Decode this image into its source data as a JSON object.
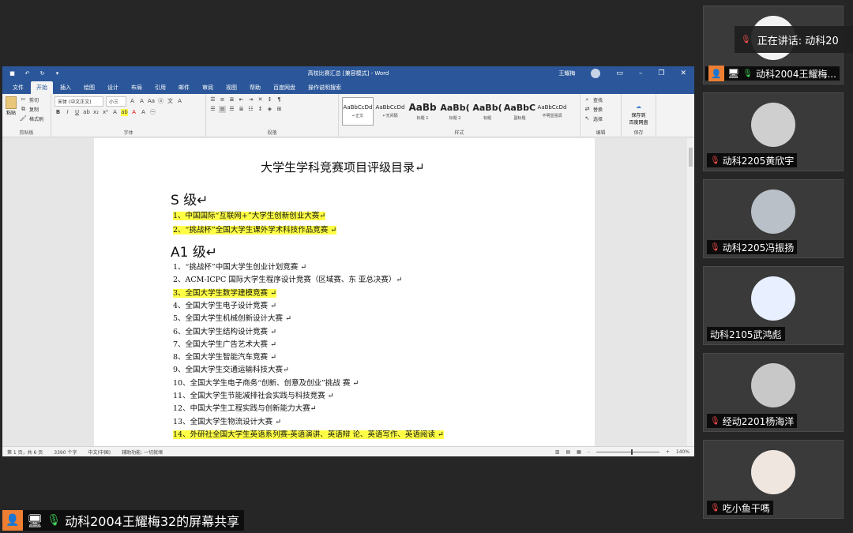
{
  "word": {
    "doc_title": "高校比赛汇总 [兼容模式] - Word",
    "user_name": "王耀梅",
    "tabs": [
      "文件",
      "开始",
      "插入",
      "绘图",
      "设计",
      "布局",
      "引用",
      "邮件",
      "审阅",
      "视图",
      "帮助",
      "百度网盘",
      "操作说明搜索"
    ],
    "active_tab_index": 1,
    "clipboard": {
      "paste": "粘贴",
      "cut": "剪切",
      "copy": "复制",
      "format_painter": "格式刷",
      "label": "剪贴板"
    },
    "font": {
      "name": "宋体 (中文正文)",
      "size": "小三",
      "label": "字体"
    },
    "paragraph_label": "段落",
    "styles": {
      "items": [
        {
          "preview": "AaBbCcDd",
          "name": "↵正文",
          "weight": "normal"
        },
        {
          "preview": "AaBbCcDd",
          "name": "↵无间隔",
          "weight": "normal"
        },
        {
          "preview": "AaBb",
          "name": "标题 1",
          "weight": "big"
        },
        {
          "preview": "AaBb(",
          "name": "标题 2",
          "weight": "mid"
        },
        {
          "preview": "AaBb(",
          "name": "标题",
          "weight": "mid"
        },
        {
          "preview": "AaBbC",
          "name": "副标题",
          "weight": "mid"
        },
        {
          "preview": "AaBbCcDd",
          "name": "不明显强调",
          "weight": "normal"
        }
      ],
      "label": "样式"
    },
    "editing": {
      "find": "查找",
      "replace": "替换",
      "select": "选择",
      "label": "编辑"
    },
    "save": {
      "line1": "保存到",
      "line2": "百度网盘",
      "label": "保存"
    },
    "status": {
      "page": "第 1 页，共 6 页",
      "words": "3390 个字",
      "lang": "中文(中国)",
      "accessibility": "辅助功能: 一切就绪",
      "zoom": "140%"
    }
  },
  "document": {
    "title": "大学生学科竞赛项目评级目录↵",
    "level_s": "S 级↵",
    "s_items": [
      "1、中国国际“互联网+”大学生创新创业大赛↵",
      "2、“挑战杯”全国大学生课外学术科技作品竞赛 ↵"
    ],
    "level_a1": "A1 级↵",
    "a1_items": [
      "1、“挑战杯”中国大学生创业计划竞赛 ↵",
      "2、ACM-ICPC 国际大学生程序设计竞赛（区域赛、东 亚总决赛）↵",
      "3、全国大学生数学建模竞赛 ↵",
      "4、全国大学生电子设计竞赛 ↵",
      "5、全国大学生机械创新设计大赛 ↵",
      "6、全国大学生结构设计竞赛 ↵",
      "7、全国大学生广告艺术大赛 ↵",
      "8、全国大学生智能汽车竞赛 ↵",
      "9、全国大学生交通运输科技大赛↵",
      "10、全国大学生电子商务“创新、创意及创业”挑战 赛 ↵",
      "11、全国大学生节能减排社会实践与科技竞赛 ↵",
      "12、中国大学生工程实践与创新能力大赛↵",
      "13、全国大学生物流设计大赛 ↵",
      "14、外研社全国大学生英语系列赛-英语演讲、英语辩 论、英语写作、英语阅读 ↵"
    ],
    "highlighted_a1": [
      2,
      13
    ]
  },
  "meeting": {
    "speaking_label": "正在讲话: 动科20",
    "presenter_tile": "动科2004王耀梅...",
    "participants": [
      {
        "name": "动科2205黄欣宇",
        "mic": "off"
      },
      {
        "name": "动科2205冯振扬",
        "mic": "off"
      },
      {
        "name": "动科2105武鸿彪",
        "mic": "none"
      },
      {
        "name": "经动2201杨海洋",
        "mic": "off"
      },
      {
        "name": "吃小鱼干嗎",
        "mic": "off"
      }
    ],
    "share_label": "动科2004王耀梅32的屏幕共享"
  }
}
